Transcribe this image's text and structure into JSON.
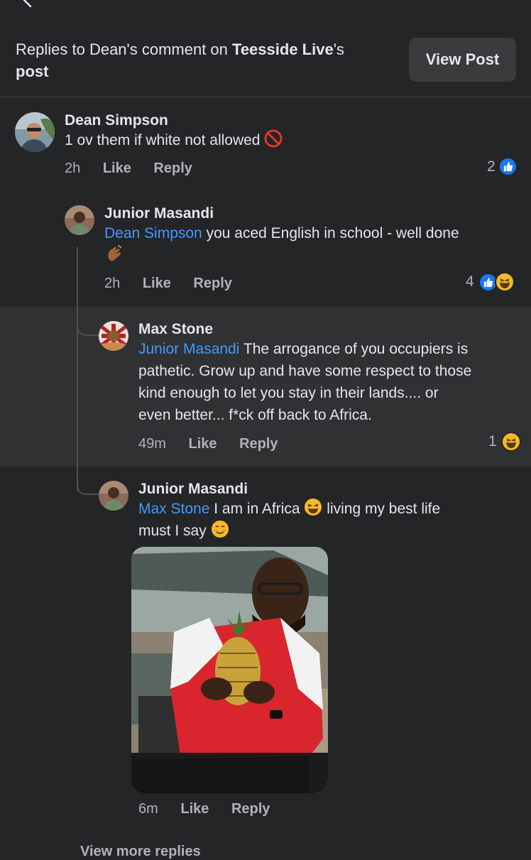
{
  "header": {
    "prefix": "Replies to Dean's comment on ",
    "page_name": "Teesside Live",
    "suffix_post": "'s",
    "post_word": "post",
    "view_post_label": "View Post"
  },
  "comments": [
    {
      "name": "Dean Simpson",
      "text": "1 ov them if white not allowed",
      "time": "2h",
      "like": "Like",
      "reply": "Reply",
      "reaction_count": "2"
    },
    {
      "name": "Junior Masandi",
      "mention": "Dean Simpson",
      "text": " you aced English in school - well done",
      "time": "2h",
      "like": "Like",
      "reply": "Reply",
      "reaction_count": "4"
    },
    {
      "name": "Max Stone",
      "mention": "Junior Masandi",
      "text_line1": " The arrogance of you occupiers is",
      "text_line2": "pathetic. Grow up and have some respect to those",
      "text_line3": "kind enough to let you stay in their lands.... or",
      "text_line4": "even better... f*ck off back to Africa.",
      "time": "49m",
      "like": "Like",
      "reply": "Reply",
      "reaction_count": "1"
    },
    {
      "name": "Junior Masandi",
      "mention": "Max Stone",
      "text_a": " I am in Africa ",
      "text_b": " living my best life",
      "text_c": "must I say ",
      "time": "6m",
      "like": "Like",
      "reply": "Reply"
    }
  ],
  "more_replies": "View more replies",
  "colors": {
    "background": "#242526",
    "highlight": "#303132",
    "mention": "#4599ff",
    "like_blue": "#1877f2",
    "haha_yellow": "#f7b928"
  }
}
